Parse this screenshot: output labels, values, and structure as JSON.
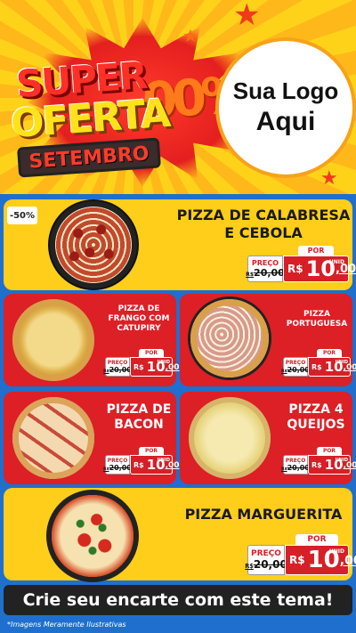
{
  "header": {
    "title_line1": "SUPER",
    "title_line2": "OFERTA",
    "zeros": "00%",
    "month": "SETEMBRO",
    "logo_line1": "Sua Logo",
    "logo_line2": "Aqui"
  },
  "discount_badge": "-50%",
  "products": [
    {
      "name_line1": "PIZZA DE CALABRESA",
      "name_line2": "E CEBOLA",
      "preco_label": "PREÇO",
      "old_currency": "R$",
      "old_price": "20,00",
      "por_label": "POR",
      "currency": "R$",
      "price_int": "10",
      "price_cents": ",00",
      "unit": "UNID"
    },
    {
      "name_line1": "PIZZA DE",
      "name_line2": "FRANGO COM",
      "name_line3": "CATUPIRY",
      "preco_label": "PREÇO",
      "old_currency": "R$",
      "old_price": "20,00",
      "por_label": "POR",
      "currency": "R$",
      "price_int": "10",
      "price_cents": ",00",
      "unit": "UNID"
    },
    {
      "name_line1": "PIZZA",
      "name_line2": "PORTUGUESA",
      "preco_label": "PREÇO",
      "old_currency": "R$",
      "old_price": "20,00",
      "por_label": "POR",
      "currency": "R$",
      "price_int": "10",
      "price_cents": ",00",
      "unit": "UNID"
    },
    {
      "name_line1": "PIZZA DE",
      "name_line2": "BACON",
      "preco_label": "PREÇO",
      "old_currency": "R$",
      "old_price": "20,00",
      "por_label": "POR",
      "currency": "R$",
      "price_int": "10",
      "price_cents": ",00",
      "unit": "UNID"
    },
    {
      "name_line1": "PIZZA 4",
      "name_line2": "QUEIJOS",
      "preco_label": "PREÇO",
      "old_currency": "R$",
      "old_price": "20,00",
      "por_label": "POR",
      "currency": "R$",
      "price_int": "10",
      "price_cents": ",00",
      "unit": "UNID"
    },
    {
      "name_line1": "PIZZA MARGUERITA",
      "preco_label": "PREÇO",
      "old_currency": "R$",
      "old_price": "20,00",
      "por_label": "POR",
      "currency": "R$",
      "price_int": "10",
      "price_cents": ",00",
      "unit": "UNID"
    }
  ],
  "cta": "Crie seu encarte com este tema!",
  "footnote": "*Imagens Meramente Ilustrativas",
  "colors": {
    "background_blue": "#1f6fcf",
    "card_yellow": "#ffce1a",
    "card_red": "#dd1f26",
    "price_red": "#d61f26"
  }
}
